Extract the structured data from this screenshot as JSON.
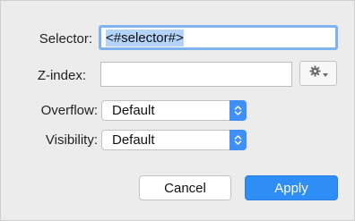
{
  "form": {
    "selector": {
      "label": "Selector:",
      "value": "<#selector#>"
    },
    "z_index": {
      "label": "Z-index:",
      "value": ""
    },
    "overflow": {
      "label": "Overflow:",
      "selected": "Default"
    },
    "visibility": {
      "label": "Visibility:",
      "selected": "Default"
    }
  },
  "icons": {
    "gear": "gear-icon",
    "dropdown": "chevron-down-icon",
    "stepper": "up-down-chevron-icon"
  },
  "buttons": {
    "cancel_label": "Cancel",
    "apply_label": "Apply"
  },
  "colors": {
    "accent": "#2f8ef6",
    "focus_ring": "#7fb3ee",
    "text_selection": "#b3d3f8",
    "background": "#ececec"
  }
}
